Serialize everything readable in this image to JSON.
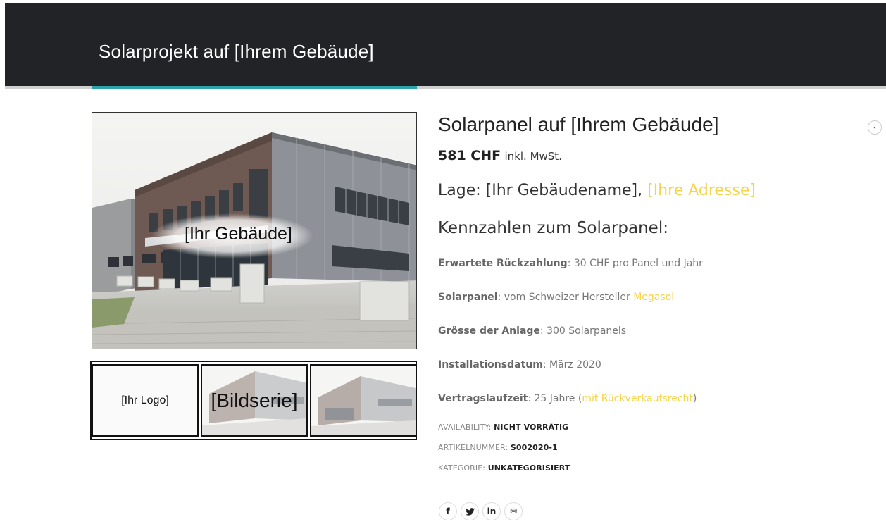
{
  "header": {
    "title": "Solarprojekt auf [Ihrem Gebäude]",
    "accent_color": "#2ca3a8",
    "background_color": "#212326"
  },
  "gallery": {
    "main_image_label": "[Ihr Gebäude]",
    "thumbnails": [
      {
        "label": "[Ihr Logo]"
      },
      {
        "label": "[Bildserie]"
      },
      {
        "label": ""
      }
    ]
  },
  "product": {
    "title": "Solarpanel auf [Ihrem Gebäude]",
    "price": "581 CHF",
    "price_tax": "inkl. MwSt.",
    "location_prefix": "Lage: [Ihr Gebäudename], ",
    "location_link": "[Ihre Adresse]",
    "link_color": "#f5d34a",
    "specs_heading": "Kennzahlen zum Solarpanel:",
    "specs": [
      {
        "key": "Erwartete Rückzahlung",
        "sep": ": ",
        "value": "30 CHF pro Panel und Jahr"
      },
      {
        "key": "Solarpanel",
        "sep": ": ",
        "value": "vom Schweizer Hersteller ",
        "link": "Megasol"
      },
      {
        "key": "Grösse der Anlage",
        "sep": ": ",
        "value": "300 Solarpanels"
      },
      {
        "key": "Installationsdatum",
        "sep": ": ",
        "value": "März 2020"
      },
      {
        "key": "Vertragslaufzeit",
        "sep": ": ",
        "value": "25 Jahre (",
        "link": "mit Rückverkaufsrecht",
        "suffix": ")"
      }
    ],
    "meta": [
      {
        "label": "AVAILABILITY: ",
        "value": "NICHT VORRÄTIG"
      },
      {
        "label": "ARTIKELNUMMER: ",
        "value": "S002020-1"
      },
      {
        "label": "KATEGORIE: ",
        "value": "UNKATEGORISIERT"
      }
    ]
  },
  "share": [
    {
      "icon": "facebook-icon",
      "glyph": "f"
    },
    {
      "icon": "twitter-icon",
      "glyph": "🐦"
    },
    {
      "icon": "linkedin-icon",
      "glyph": "in"
    },
    {
      "icon": "email-icon",
      "glyph": "✉"
    }
  ],
  "side_toggle": {
    "icon": "chevron-left-icon",
    "glyph": "‹"
  }
}
